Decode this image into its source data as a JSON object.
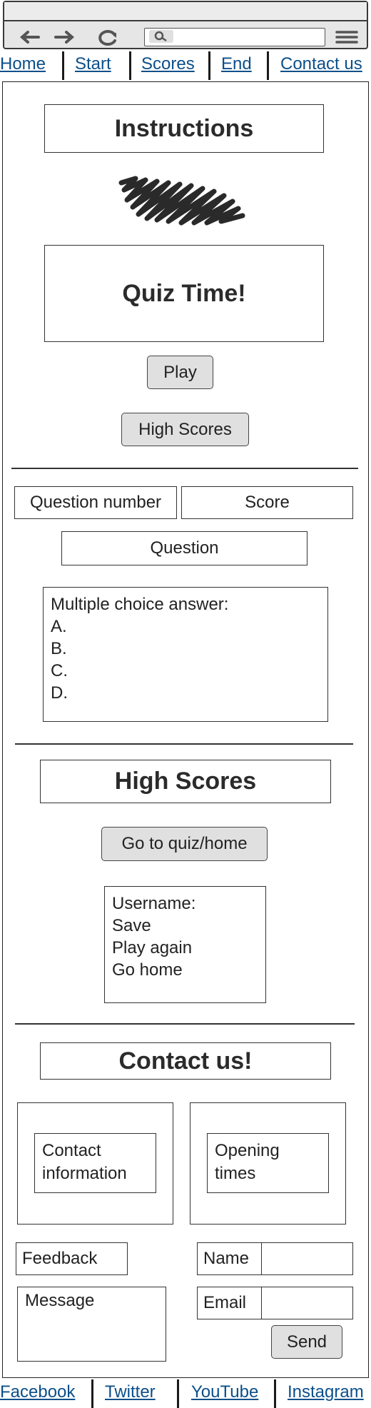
{
  "nav": {
    "home": "Home",
    "start": "Start",
    "scores": "Scores",
    "end": "End",
    "contact": "Contact us"
  },
  "instructions": {
    "title": "Instructions",
    "quiz_title": "Quiz Time!",
    "play": "Play",
    "high_scores_button": "High Scores"
  },
  "quiz": {
    "question_number": "Question number",
    "score": "Score",
    "question": "Question",
    "answers_heading": "Multiple choice answer:",
    "options": [
      "A.",
      "B.",
      "C.",
      "D."
    ]
  },
  "high_scores": {
    "title": "High Scores",
    "go_button": "Go to quiz/home",
    "items": [
      "Username:",
      "Save",
      "Play again",
      "Go home"
    ]
  },
  "contact": {
    "title": "Contact us!",
    "info": "Contact information",
    "opening": "Opening times",
    "feedback": "Feedback",
    "message": "Message",
    "name": "Name",
    "email": "Email",
    "send": "Send"
  },
  "footer": {
    "facebook": "Facebook",
    "twitter": "Twitter",
    "youtube": "YouTube",
    "instagram": "Instagram"
  },
  "icons": [
    "back-arrow-icon",
    "forward-arrow-icon",
    "reload-icon",
    "search-icon",
    "hamburger-menu-icon",
    "scribble-image-placeholder"
  ]
}
